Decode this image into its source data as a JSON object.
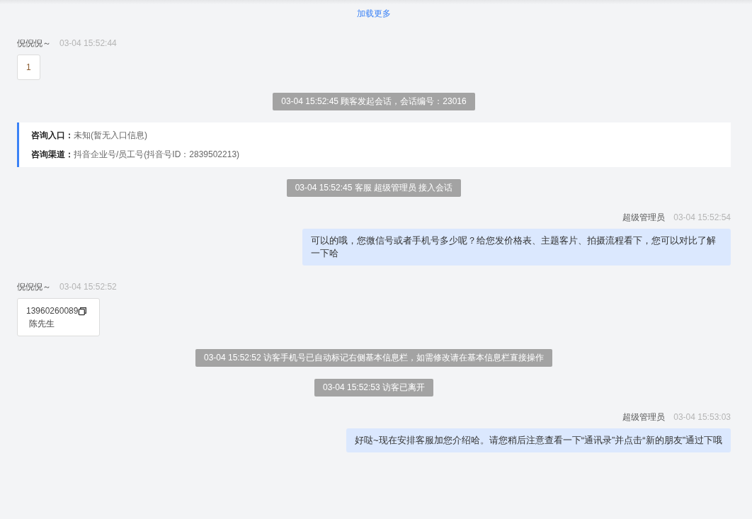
{
  "load_more": "加载更多",
  "messages": [
    {
      "kind": "visitor",
      "sender": "倪倪倪～",
      "time": "03-04 15:52:44",
      "text": "1"
    },
    {
      "kind": "system",
      "text": "03-04 15:52:45 顾客发起会话，会话编号：23016"
    },
    {
      "kind": "info_card",
      "lines": [
        {
          "label": "咨询入口：",
          "value": "未知(暂无入口信息)"
        },
        {
          "label": "咨询渠道：",
          "value": "抖音企业号/员工号(抖音号ID：2839502213)"
        }
      ]
    },
    {
      "kind": "system",
      "text": "03-04 15:52:45 客服 超级管理员 接入会话"
    },
    {
      "kind": "agent",
      "sender": "超级管理员",
      "time": "03-04 15:52:54",
      "text": "可以的哦，您微信号或者手机号多少呢？给您发价格表、主题客片、拍摄流程看下，您可以对比了解一下哈"
    },
    {
      "kind": "contact",
      "sender": "倪倪倪～",
      "time": "03-04 15:52:52",
      "phone": "13960260089",
      "name": "陈先生"
    },
    {
      "kind": "system",
      "text": "03-04 15:52:52 访客手机号已自动标记右侧基本信息栏，如需修改请在基本信息栏直接操作"
    },
    {
      "kind": "system",
      "text": "03-04 15:52:53 访客已离开"
    },
    {
      "kind": "agent",
      "sender": "超级管理员",
      "time": "03-04 15:53:03",
      "text": "好哒~现在安排客服加您介绍哈。请您稍后注意查看一下“通讯录”并点击“新的朋友”通过下哦"
    }
  ]
}
